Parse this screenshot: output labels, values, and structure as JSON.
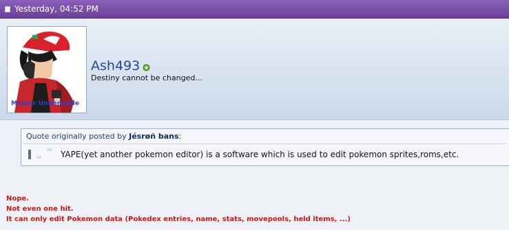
{
  "post": {
    "date": "Yesterday, 04:52 PM"
  },
  "user": {
    "name": "Ash493",
    "title": "Destiny cannot be changed...",
    "avatar_caption": "Master Undeniable",
    "online_status": "online"
  },
  "quote": {
    "prefix": "Quote originally posted by",
    "author": "Jésrøñ bans",
    "suffix": ":",
    "text": "YAPE(yet another pokemon editor) is a software which is used to edit pokemon sprites,roms,etc."
  },
  "reply": {
    "lines": [
      "Nope.",
      "Not even one hit.",
      "It can only edit Pokemon data (Pokedex entries, name, stats, movepools, held items, ...)"
    ]
  },
  "colors": {
    "header_purple": "#7b4fb0",
    "username_blue": "#1f4a9a",
    "reply_red": "#d31414"
  }
}
